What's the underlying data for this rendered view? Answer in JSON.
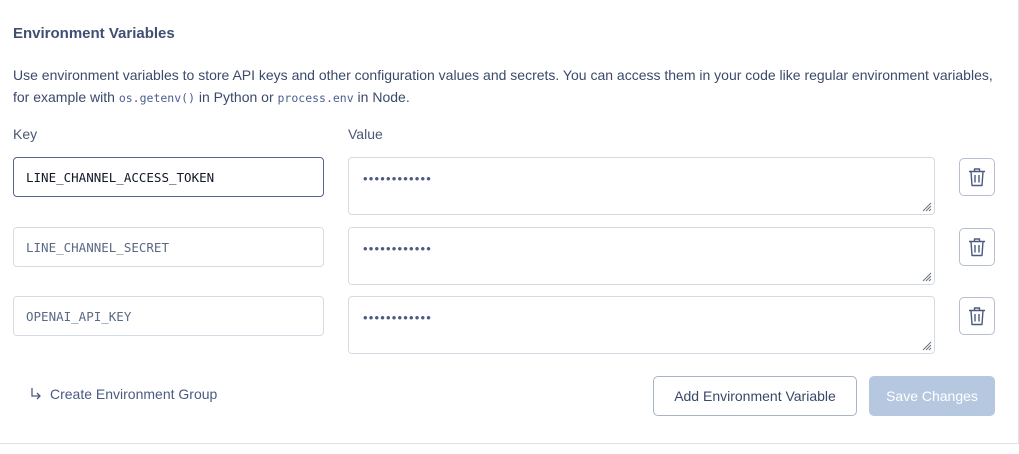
{
  "section": {
    "title": "Environment Variables",
    "description": {
      "part1": "Use environment variables to store API keys and other configuration values and secrets. You can access them in your code like regular environment variables, for example with ",
      "code1": "os.getenv()",
      "part2": " in Python or ",
      "code2": "process.env",
      "part3": " in Node."
    }
  },
  "columns": {
    "key": "Key",
    "value": "Value"
  },
  "variables": [
    {
      "key": "LINE_CHANNEL_ACCESS_TOKEN",
      "value_masked": "••••••••••••"
    },
    {
      "key": "LINE_CHANNEL_SECRET",
      "value_masked": "••••••••••••"
    },
    {
      "key": "OPENAI_API_KEY",
      "value_masked": "••••••••••••"
    }
  ],
  "actions": {
    "create_group": "Create Environment Group",
    "add_variable": "Add Environment Variable",
    "save_changes": "Save Changes"
  },
  "icons": {
    "delete": "trash-icon",
    "create_group": "arrow-turn-down-right-icon",
    "resize": "resize-grip-icon"
  },
  "colors": {
    "accent": "#3f4f73",
    "save_disabled": "#b6c8e0",
    "border": "#d5dbe5"
  }
}
